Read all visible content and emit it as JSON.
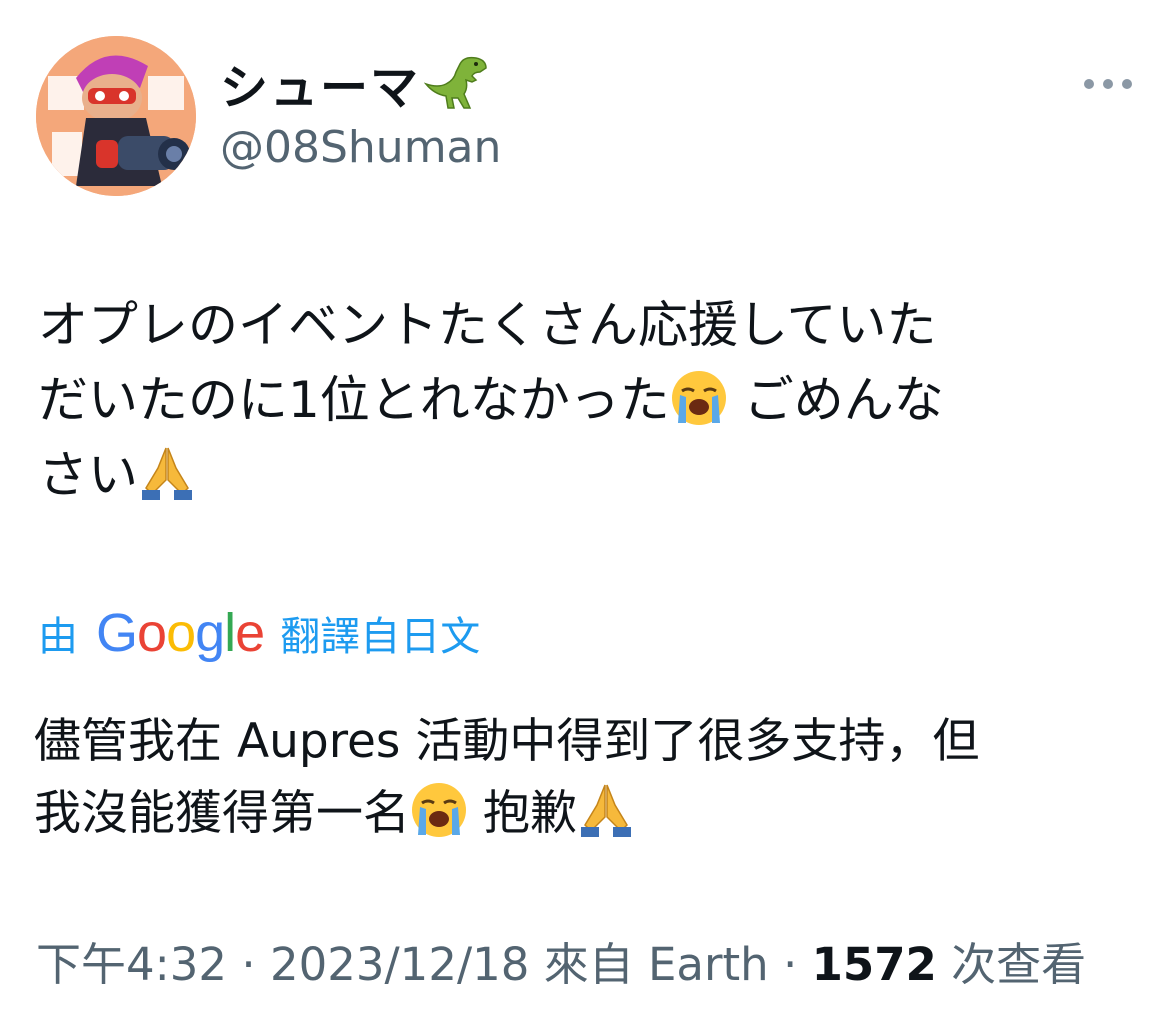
{
  "author": {
    "display_name": "シューマ",
    "display_name_emoji": "t-rex-emoji",
    "handle": "@08Shuman"
  },
  "tweet": {
    "line1": "オプレのイベントたくさん応援していた",
    "line2_a": "だいたのに1位とれなかった",
    "line2_b": "ごめんな",
    "line3": "さい",
    "emojis": [
      "loudly-crying-face",
      "folded-hands"
    ]
  },
  "translation": {
    "prefix": "由",
    "provider": "Google",
    "suffix": "翻譯自日文",
    "line1": "儘管我在 Aupres 活動中得到了很多支持，但",
    "line2_a": "我沒能獲得第一名",
    "line2_b": "抱歉"
  },
  "meta": {
    "time": "下午4:32",
    "sep1": "·",
    "date": "2023/12/18",
    "source": "來自 Earth",
    "sep2": "·",
    "views_count": "1572",
    "views_label": "次查看"
  },
  "colors": {
    "link_blue": "#1d9bf0",
    "secondary_text": "#536471",
    "google_blue": "#4285F4",
    "google_red": "#EA4335",
    "google_yellow": "#FBBC05",
    "google_green": "#34A853"
  }
}
